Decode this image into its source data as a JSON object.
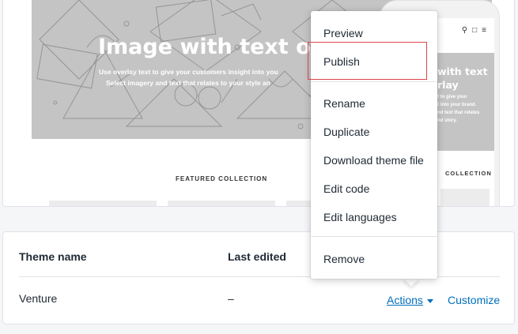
{
  "preview": {
    "hero_title": "Image with text ove",
    "hero_sub_line1": "Use overlay text to give your customers insight into you",
    "hero_sub_line2": "Select imagery and text that relates to your style an",
    "featured_label": "FEATURED COLLECTION",
    "mobile_title_line1": "with text",
    "mobile_title_line2": "rlay",
    "mobile_sub_line1": "t to give your",
    "mobile_sub_line2": "t into your brand.",
    "mobile_sub_line3": "nd text that relates",
    "mobile_sub_line4": "nd story.",
    "mobile_featured_label": "COLLECTION",
    "mobile_icons": "search-icon cart-icon menu-icon"
  },
  "menu": {
    "items": [
      "Preview",
      "Publish",
      "Rename",
      "Duplicate",
      "Download theme file",
      "Edit code",
      "Edit languages",
      "Remove"
    ],
    "highlighted": "Publish"
  },
  "table": {
    "headers": {
      "theme_name": "Theme name",
      "last_edited": "Last edited"
    },
    "row": {
      "name": "Venture",
      "last_edited": "–",
      "actions_label": "Actions",
      "customize_label": "Customize"
    }
  },
  "colors": {
    "link": "#006fbb",
    "highlight": "#d9454c",
    "hero_gray": "#c4c4c4"
  }
}
